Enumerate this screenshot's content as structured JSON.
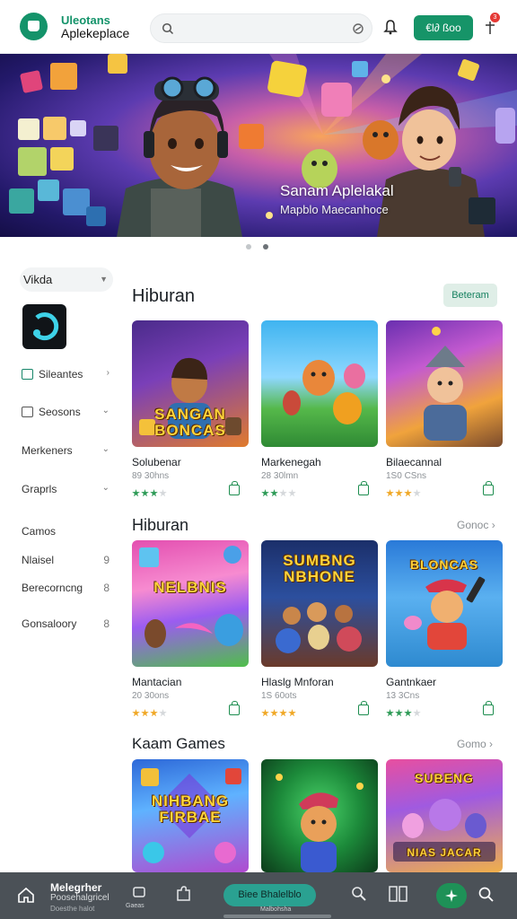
{
  "header": {
    "brand_line1": "Uleotans",
    "brand_line2": "Aplekeplace",
    "search_placeholder": "",
    "cta_label": "€l∂ ßoo",
    "notification_count": "3"
  },
  "hero": {
    "title": "Sanam Aplelakal",
    "subtitle": "Mapblo Maecanhoce",
    "slide_count": 2,
    "active_slide": 2
  },
  "sidebar": {
    "filter_label": "Vikda",
    "items": [
      {
        "label": "Sileantes",
        "icon": "square-icon"
      },
      {
        "label": "Seosons",
        "icon": "square-icon"
      },
      {
        "label": "Merkeners"
      },
      {
        "label": "Graprls"
      },
      {
        "label": "Camos"
      },
      {
        "label": "Nlaisel",
        "count": "9"
      },
      {
        "label": "Berecorncng",
        "count": "8"
      },
      {
        "label": "Gonsaloory",
        "count": "8"
      }
    ]
  },
  "sections": [
    {
      "title": "Hiburan",
      "action_label": "Beteram",
      "cards": [
        {
          "thumb_text": "SANGAN BONCAS",
          "name": "Solubenar",
          "meta": "89 30hns",
          "rating": 3,
          "star_color": "green"
        },
        {
          "thumb_text": "",
          "name": "Markenegah",
          "meta": "28 30lmn",
          "rating": 2,
          "star_color": "green"
        },
        {
          "thumb_text": "",
          "name": "Bilaecannal",
          "meta": "1S0 CSns",
          "rating": 3,
          "star_color": "gold"
        }
      ]
    },
    {
      "title": "Hiburan",
      "action_label": "Gonoc",
      "cards": [
        {
          "thumb_text": "NELBNIS",
          "name": "Mantacian",
          "meta": "20 30ons",
          "rating": 3,
          "star_color": "gold"
        },
        {
          "thumb_text": "SUMBNG NBHONE",
          "name": "Hlaslg Mnforan",
          "meta": "1S 60ots",
          "rating": 4,
          "star_color": "gold"
        },
        {
          "thumb_text": "BLONCAS",
          "name": "Gantnkaer",
          "meta": "13 3Cns",
          "rating": 3,
          "star_color": "green"
        }
      ]
    },
    {
      "title": "Kaam Games",
      "action_label": "Gomo",
      "cards": [
        {
          "thumb_text": "NIHBANG FIRBAE",
          "name": "",
          "meta": "",
          "rating": 0,
          "star_color": "green"
        },
        {
          "thumb_text": "",
          "name": "",
          "meta": "",
          "rating": 0,
          "star_color": "green"
        },
        {
          "thumb_text": "NIAS JACAR",
          "name": "",
          "meta": "",
          "rating": 0,
          "star_color": "green"
        }
      ]
    }
  ],
  "bottom_nav": {
    "brand_a": "Melegrher",
    "brand_b": "Poosehalgricel",
    "brand_c": "Doesthe halot",
    "tab_games": "Gaeas",
    "pill_label": "Biee Bhalelblo",
    "pill_sub": "Malbohsha"
  },
  "colors": {
    "brand_green": "#169468",
    "hero_accent": "#5c3bb0",
    "nav_bg": "#4b5157"
  }
}
